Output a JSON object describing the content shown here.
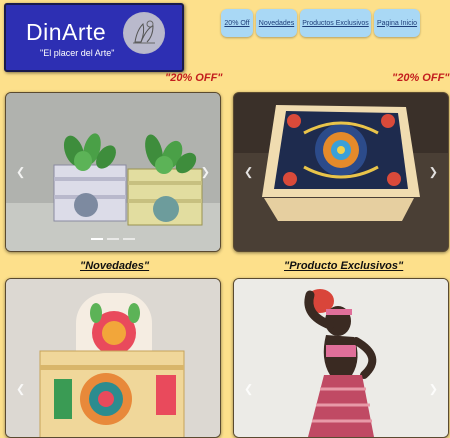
{
  "logo": {
    "name": "DinArte",
    "slogan": "\"El placer del Arte\""
  },
  "nav": [
    {
      "label": "20% Off"
    },
    {
      "label": "Novedades"
    },
    {
      "label": "Productos Exclusivos"
    },
    {
      "label": "Pagina Inicio"
    }
  ],
  "offers": {
    "left": "\"20% OFF\"",
    "right": "\"20% OFF\""
  },
  "captions": {
    "left": "\"Novedades\"",
    "right": "\"Producto Exclusivos\""
  },
  "colors": {
    "background": "#fde08b",
    "logo_background": "#2d2fb3",
    "nav_button": "#a9d8f5",
    "offer_text": "#c31d1d"
  },
  "icons": {
    "prev": "chevron-left-icon",
    "next": "chevron-right-icon"
  }
}
